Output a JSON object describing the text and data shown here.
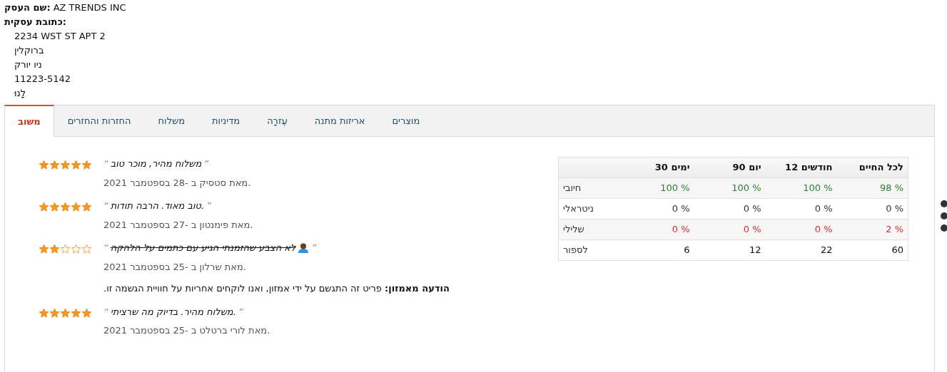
{
  "business": {
    "name_label": "שם העסק:",
    "name": "AZ TRENDS INC",
    "address_label": "כתובת עסקית:",
    "address_lines": [
      "2234 WST ST APT 2",
      "ברוקלין",
      "ניו יורק",
      "11223-5142",
      "לָנוּ"
    ]
  },
  "tabs": [
    {
      "label": "מוצרים",
      "selected": false
    },
    {
      "label": "אריזות מתנה",
      "selected": false
    },
    {
      "label": "עֶזרָה",
      "selected": false
    },
    {
      "label": "מדיניות",
      "selected": false
    },
    {
      "label": "משלוח",
      "selected": false
    },
    {
      "label": "החזרות והחזרים",
      "selected": false
    },
    {
      "label": "משוב",
      "selected": true
    }
  ],
  "reviews": [
    {
      "stars": 5,
      "quote_open": "“",
      "text": "משלוח מהיר, מוכר טוב",
      "quote_close": "”",
      "struck": false,
      "emoji": false,
      "byline": "מאת סטסיק ב -28 בספטמבר 2021."
    },
    {
      "stars": 5,
      "quote_open": "“",
      "text": "טוב מאוד. הרבה תודות.",
      "quote_close": "”",
      "struck": false,
      "emoji": false,
      "byline": "מאת פימנטון ב -27 בספטמבר 2021."
    },
    {
      "stars": 2,
      "quote_open": "“",
      "text": "לא הצבע שהזמנתי הגיע עם כתמים על הלהקה",
      "quote_close": "”",
      "struck": true,
      "emoji": true,
      "byline": "מאת שרלון ב -25 בספטמבר 2021.",
      "notice": "**הודעה מאמזון:** פריט זה התגשם על ידי אמזון, ואנו לוקחים אחריות על חוויית הגשמה זו."
    },
    {
      "stars": 5,
      "quote_open": "“",
      "text": "משלוח מהיר. בדיוק מה שרציתי.",
      "quote_close": "”",
      "struck": false,
      "emoji": false,
      "byline": "מאת לורי ברטלט ב -25 בספטמבר 2021."
    }
  ],
  "ratings_table": {
    "columns": [
      "לכל החיים",
      "חודשים 12",
      "יום 90",
      "ימים 30"
    ],
    "rows": [
      {
        "kind": "positive",
        "values": [
          "98 %",
          "100 %",
          "100 %",
          "100 %"
        ],
        "label": "חיובי"
      },
      {
        "kind": "neutral",
        "values": [
          "0 %",
          "0 %",
          "0 %",
          "0 %"
        ],
        "label": "ניטראלי"
      },
      {
        "kind": "negative",
        "values": [
          "2 %",
          "0 %",
          "0 %",
          "0 %"
        ],
        "label": "שלילי"
      },
      {
        "kind": "count",
        "values": [
          "60",
          "22",
          "12",
          "6"
        ],
        "label": "לספור"
      }
    ]
  }
}
